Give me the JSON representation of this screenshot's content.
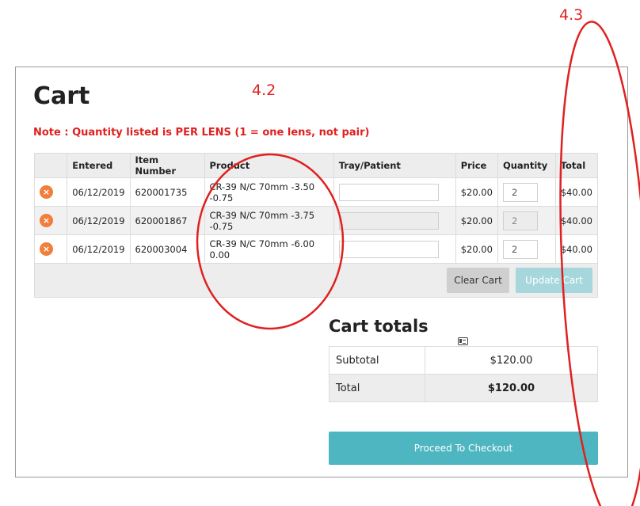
{
  "page": {
    "title": "Cart",
    "note": "Note : Quantity listed is PER LENS (1 = one lens, not pair)"
  },
  "cart_table": {
    "headers": [
      "",
      "Entered",
      "Item Number",
      "Product",
      "Tray/Patient",
      "Price",
      "Quantity",
      "Total"
    ],
    "rows": [
      {
        "entered": "06/12/2019",
        "item_number": "620001735",
        "product": "CR-39 N/C 70mm -3.50 -0.75",
        "tray": "",
        "price": "$20.00",
        "quantity": "2",
        "total": "$40.00"
      },
      {
        "entered": "06/12/2019",
        "item_number": "620001867",
        "product": "CR-39 N/C 70mm -3.75 -0.75",
        "tray": "",
        "price": "$20.00",
        "quantity": "2",
        "total": "$40.00"
      },
      {
        "entered": "06/12/2019",
        "item_number": "620003004",
        "product": "CR-39 N/C 70mm -6.00 0.00",
        "tray": "",
        "price": "$20.00",
        "quantity": "2",
        "total": "$40.00"
      }
    ],
    "remove_symbol": "×",
    "clear_cart_label": "Clear Cart",
    "update_cart_label": "Update Cart"
  },
  "totals": {
    "title": "Cart totals",
    "subtotal_label": "Subtotal",
    "subtotal_value": "$120.00",
    "total_label": "Total",
    "total_value": "$120.00"
  },
  "checkout": {
    "label": "Proceed To Checkout"
  },
  "annotations": {
    "label_1": "4.2",
    "label_2": "4.3",
    "color": "#e02020"
  },
  "colors": {
    "remove_icon": "#f07f3c",
    "checkout": "#4db6c0",
    "update_cart": "#a6d7dc",
    "note_text": "#e02020"
  }
}
